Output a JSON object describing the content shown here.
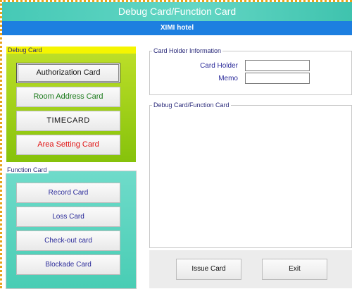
{
  "window": {
    "title": "Debug Card/Function Card",
    "hotel": "XIMI hotel"
  },
  "debug_section": {
    "label": "Debug Card",
    "buttons": [
      {
        "label": "Authorization Card",
        "color": "#111111"
      },
      {
        "label": "Room Address Card",
        "color": "#1a7a1a"
      },
      {
        "label": "TIMECARD",
        "color": "#111111"
      },
      {
        "label": "Area Setting Card",
        "color": "#e01010"
      }
    ]
  },
  "function_section": {
    "label": "Function Card",
    "buttons": [
      {
        "label": "Record Card"
      },
      {
        "label": "Loss Card"
      },
      {
        "label": "Check-out card"
      },
      {
        "label": "Blockade Card"
      }
    ]
  },
  "holder_info": {
    "label": "Card Holder Information",
    "card_holder_label": "Card Holder",
    "card_holder_value": "",
    "memo_label": "Memo",
    "memo_value": ""
  },
  "output": {
    "label": "Debug Card/Function Card"
  },
  "actions": {
    "issue": "Issue Card",
    "exit": "Exit"
  }
}
